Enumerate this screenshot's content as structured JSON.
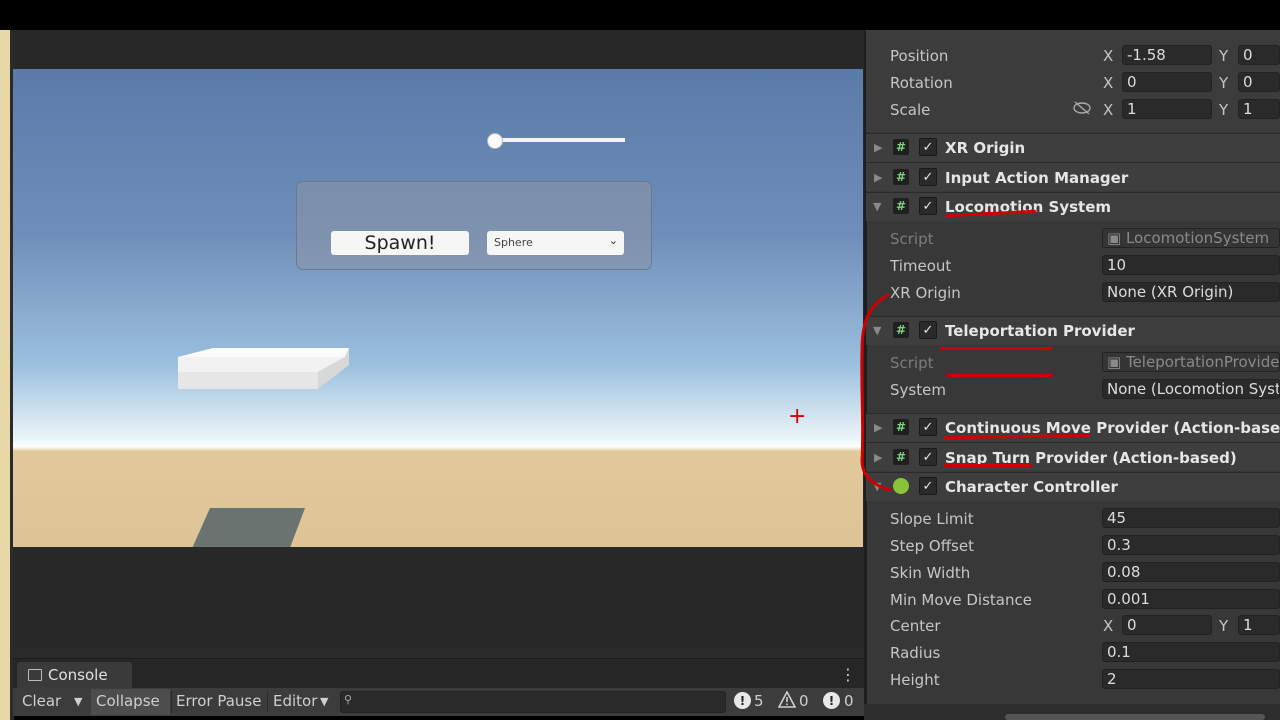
{
  "game_view": {
    "spawn_button_label": "Spawn!",
    "shape_dropdown_value": "Sphere",
    "slider_value": 0
  },
  "console": {
    "tab_title": "Console",
    "toolbar": {
      "clear": "Clear",
      "collapse": "Collapse",
      "error_pause": "Error Pause",
      "editor": "Editor",
      "search_placeholder": "",
      "log_count": "5",
      "warning_count": "0",
      "error_count": "0"
    }
  },
  "inspector": {
    "transform": {
      "position": {
        "label": "Position",
        "x": "-1.58",
        "y": "0"
      },
      "rotation": {
        "label": "Rotation",
        "x": "0",
        "y": "0"
      },
      "scale": {
        "label": "Scale",
        "x": "1",
        "y": "1"
      }
    },
    "components": {
      "xr_origin": "XR Origin",
      "input_action_manager": "Input Action Manager",
      "locomotion_system": {
        "title": "Locomotion System",
        "script_label": "Script",
        "script_value": "LocomotionSystem",
        "timeout_label": "Timeout",
        "timeout_value": "10",
        "xr_origin_label": "XR Origin",
        "xr_origin_value": "None (XR Origin)"
      },
      "teleportation_provider": {
        "title": "Teleportation Provider",
        "script_label": "Script",
        "script_value": "TeleportationProvide",
        "system_label": "System",
        "system_value": "None (Locomotion Syst"
      },
      "continuous_move_provider": "Continuous Move Provider (Action-based)",
      "snap_turn_provider": "Snap Turn Provider (Action-based)",
      "character_controller": {
        "title": "Character Controller",
        "slope_limit_label": "Slope Limit",
        "slope_limit_value": "45",
        "step_offset_label": "Step Offset",
        "step_offset_value": "0.3",
        "skin_width_label": "Skin Width",
        "skin_width_value": "0.08",
        "min_move_distance_label": "Min Move Distance",
        "min_move_distance_value": "0.001",
        "center_label": "Center",
        "center_x": "0",
        "center_y": "1",
        "radius_label": "Radius",
        "radius_value": "0.1",
        "height_label": "Height",
        "height_value": "2"
      }
    },
    "axis_labels": {
      "x": "X",
      "y": "Y"
    }
  },
  "colors": {
    "annotation_red": "#d00000",
    "script_icon_green": "#7fd080",
    "editor_dark": "#383838"
  }
}
